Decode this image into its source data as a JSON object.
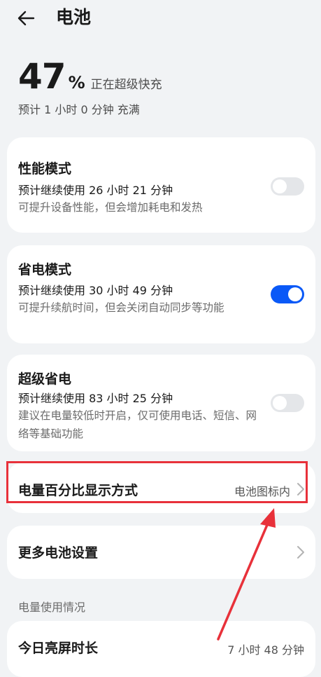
{
  "header": {
    "title": "电池"
  },
  "battery": {
    "percent": "47",
    "percent_sign": "%",
    "status": "正在超级快充",
    "estimate": "预计 1 小时 0 分钟 充满"
  },
  "modes": [
    {
      "title": "性能模式",
      "usage": "预计继续使用 26 小时 21 分钟",
      "desc": "可提升设备性能，但会增加耗电和发热",
      "enabled": false
    },
    {
      "title": "省电模式",
      "usage": "预计继续使用 30 小时 49 分钟",
      "desc": "可提升续航时间，但会关闭自动同步等功能",
      "enabled": true
    },
    {
      "title": "超级省电",
      "usage": "预计继续使用 83 小时 25 分钟",
      "desc": "建议在电量较低时开启，仅可使用电话、短信、网络等基础功能",
      "enabled": false
    }
  ],
  "percent_display": {
    "title": "电量百分比显示方式",
    "value": "电池图标内"
  },
  "more_settings": {
    "title": "更多电池设置"
  },
  "usage_section": {
    "label": "电量使用情况"
  },
  "screen_time": {
    "title": "今日亮屏时长",
    "value": "7 小时 48 分钟"
  },
  "colors": {
    "accent": "#0a59f7",
    "annotation": "#e8313a",
    "background": "#f1f3f5"
  }
}
